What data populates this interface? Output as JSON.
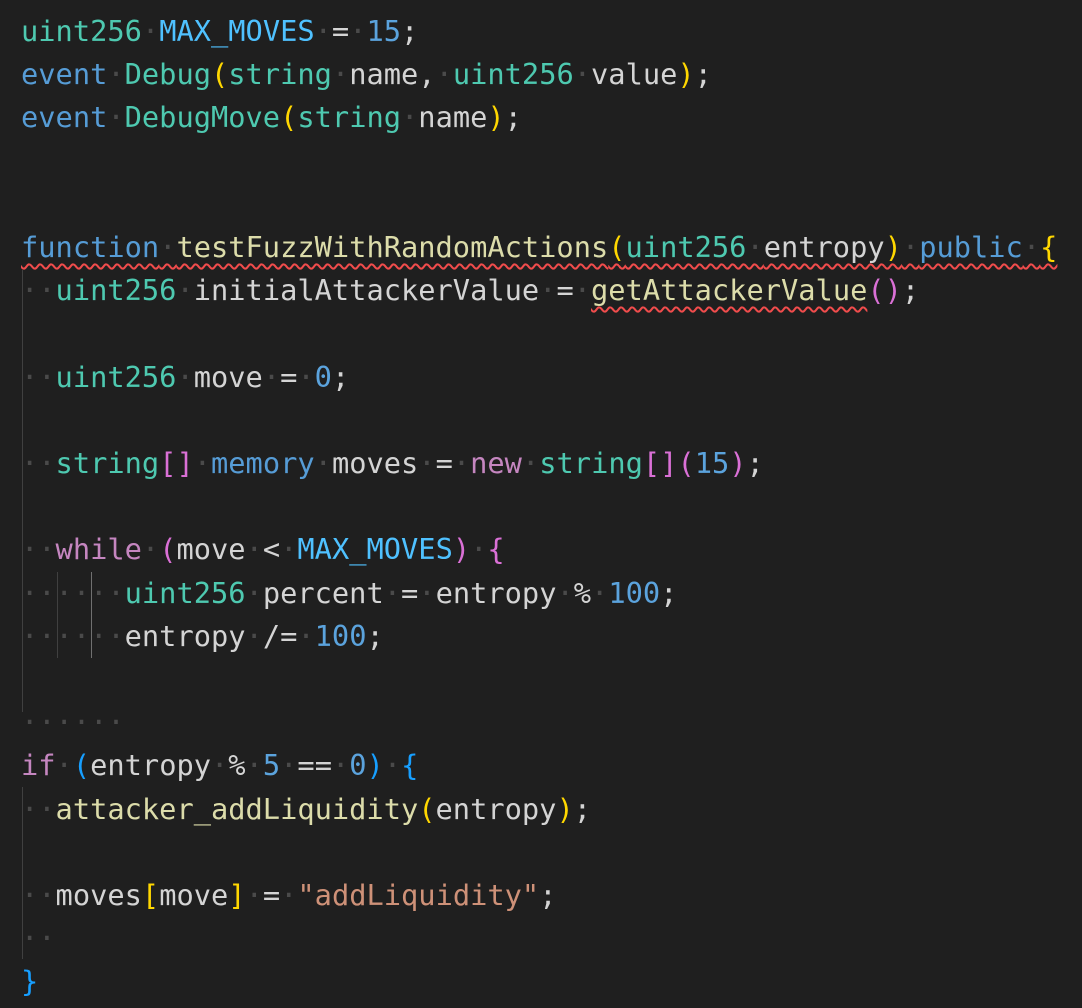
{
  "colors": {
    "background": "#1f1f1f",
    "keyword": "#569cd6",
    "control": "#c586c0",
    "type": "#4ec9b0",
    "function": "#dcdcaa",
    "variable": "#d4d4d4",
    "constant": "#4fc1ff",
    "number": "#5ba3dd",
    "string": "#ce9178",
    "bracket1": "#ffd700",
    "bracket2": "#da70d6",
    "bracket3": "#179fff",
    "whitespace": "#4a4a4a",
    "error": "#f14c4c"
  },
  "lines": [
    {
      "tokens": [
        {
          "t": "uint256",
          "c": "type"
        },
        {
          "t": "·",
          "c": "whitespace"
        },
        {
          "t": "MAX_MOVES",
          "c": "constant"
        },
        {
          "t": "·",
          "c": "whitespace"
        },
        {
          "t": "=",
          "c": "variable"
        },
        {
          "t": "·",
          "c": "whitespace"
        },
        {
          "t": "15",
          "c": "number"
        },
        {
          "t": ";",
          "c": "variable"
        }
      ]
    },
    {
      "tokens": [
        {
          "t": "event",
          "c": "keyword"
        },
        {
          "t": "·",
          "c": "whitespace"
        },
        {
          "t": "Debug",
          "c": "type"
        },
        {
          "t": "(",
          "c": "bracket1"
        },
        {
          "t": "string",
          "c": "type"
        },
        {
          "t": "·",
          "c": "whitespace"
        },
        {
          "t": "name,",
          "c": "variable"
        },
        {
          "t": "·",
          "c": "whitespace"
        },
        {
          "t": "uint256",
          "c": "type"
        },
        {
          "t": "·",
          "c": "whitespace"
        },
        {
          "t": "value",
          "c": "variable"
        },
        {
          "t": ")",
          "c": "bracket1"
        },
        {
          "t": ";",
          "c": "variable"
        }
      ]
    },
    {
      "tokens": [
        {
          "t": "event",
          "c": "keyword"
        },
        {
          "t": "·",
          "c": "whitespace"
        },
        {
          "t": "DebugMove",
          "c": "type"
        },
        {
          "t": "(",
          "c": "bracket1"
        },
        {
          "t": "string",
          "c": "type"
        },
        {
          "t": "·",
          "c": "whitespace"
        },
        {
          "t": "name",
          "c": "variable"
        },
        {
          "t": ")",
          "c": "bracket1"
        },
        {
          "t": ";",
          "c": "variable"
        }
      ]
    },
    {
      "tokens": []
    },
    {
      "tokens": []
    },
    {
      "tokens": [
        {
          "t": "function",
          "c": "keyword",
          "err": true
        },
        {
          "t": "·",
          "c": "whitespace",
          "err": true
        },
        {
          "t": "testFuzzWithRandomActions",
          "c": "function",
          "err": true
        },
        {
          "t": "(",
          "c": "bracket1",
          "err": true
        },
        {
          "t": "uint256",
          "c": "type",
          "err": true
        },
        {
          "t": "·",
          "c": "whitespace",
          "err": true
        },
        {
          "t": "entropy",
          "c": "variable",
          "err": true
        },
        {
          "t": ")",
          "c": "bracket1",
          "err": true
        },
        {
          "t": "·",
          "c": "whitespace",
          "err": true
        },
        {
          "t": "public",
          "c": "keyword",
          "err": true
        },
        {
          "t": "·",
          "c": "whitespace",
          "err": true
        },
        {
          "t": "{",
          "c": "bracket1",
          "err": true
        }
      ]
    },
    {
      "tokens": [
        {
          "t": "··",
          "c": "whitespace"
        },
        {
          "t": "uint256",
          "c": "type"
        },
        {
          "t": "·",
          "c": "whitespace"
        },
        {
          "t": "initialAttackerValue",
          "c": "variable"
        },
        {
          "t": "·",
          "c": "whitespace"
        },
        {
          "t": "=",
          "c": "variable"
        },
        {
          "t": "·",
          "c": "whitespace"
        },
        {
          "t": "getAttackerValue",
          "c": "function",
          "err": true
        },
        {
          "t": "()",
          "c": "bracket2"
        },
        {
          "t": ";",
          "c": "variable"
        }
      ]
    },
    {
      "tokens": []
    },
    {
      "tokens": [
        {
          "t": "··",
          "c": "whitespace"
        },
        {
          "t": "uint256",
          "c": "type"
        },
        {
          "t": "·",
          "c": "whitespace"
        },
        {
          "t": "move",
          "c": "variable"
        },
        {
          "t": "·",
          "c": "whitespace"
        },
        {
          "t": "=",
          "c": "variable"
        },
        {
          "t": "·",
          "c": "whitespace"
        },
        {
          "t": "0",
          "c": "number"
        },
        {
          "t": ";",
          "c": "variable"
        }
      ]
    },
    {
      "tokens": []
    },
    {
      "tokens": [
        {
          "t": "··",
          "c": "whitespace"
        },
        {
          "t": "string",
          "c": "type"
        },
        {
          "t": "[]",
          "c": "bracket2"
        },
        {
          "t": "·",
          "c": "whitespace"
        },
        {
          "t": "memory",
          "c": "keyword"
        },
        {
          "t": "·",
          "c": "whitespace"
        },
        {
          "t": "moves",
          "c": "variable"
        },
        {
          "t": "·",
          "c": "whitespace"
        },
        {
          "t": "=",
          "c": "variable"
        },
        {
          "t": "·",
          "c": "whitespace"
        },
        {
          "t": "new",
          "c": "control"
        },
        {
          "t": "·",
          "c": "whitespace"
        },
        {
          "t": "string",
          "c": "type"
        },
        {
          "t": "[]",
          "c": "bracket2"
        },
        {
          "t": "(",
          "c": "bracket2"
        },
        {
          "t": "15",
          "c": "number"
        },
        {
          "t": ")",
          "c": "bracket2"
        },
        {
          "t": ";",
          "c": "variable"
        }
      ]
    },
    {
      "tokens": []
    },
    {
      "tokens": [
        {
          "t": "··",
          "c": "whitespace"
        },
        {
          "t": "while",
          "c": "control"
        },
        {
          "t": "·",
          "c": "whitespace"
        },
        {
          "t": "(",
          "c": "bracket2"
        },
        {
          "t": "move",
          "c": "variable"
        },
        {
          "t": "·",
          "c": "whitespace"
        },
        {
          "t": "<",
          "c": "variable"
        },
        {
          "t": "·",
          "c": "whitespace"
        },
        {
          "t": "MAX_MOVES",
          "c": "constant"
        },
        {
          "t": ")",
          "c": "bracket2"
        },
        {
          "t": "·",
          "c": "whitespace"
        },
        {
          "t": "{",
          "c": "bracket2"
        }
      ]
    },
    {
      "tokens": [
        {
          "t": "······",
          "c": "whitespace"
        },
        {
          "t": "uint256",
          "c": "type"
        },
        {
          "t": "·",
          "c": "whitespace"
        },
        {
          "t": "percent",
          "c": "variable"
        },
        {
          "t": "·",
          "c": "whitespace"
        },
        {
          "t": "=",
          "c": "variable"
        },
        {
          "t": "·",
          "c": "whitespace"
        },
        {
          "t": "entropy",
          "c": "variable"
        },
        {
          "t": "·",
          "c": "whitespace"
        },
        {
          "t": "%",
          "c": "variable"
        },
        {
          "t": "·",
          "c": "whitespace"
        },
        {
          "t": "100",
          "c": "number"
        },
        {
          "t": ";",
          "c": "variable"
        }
      ]
    },
    {
      "tokens": [
        {
          "t": "······",
          "c": "whitespace"
        },
        {
          "t": "entropy",
          "c": "variable"
        },
        {
          "t": "·",
          "c": "whitespace"
        },
        {
          "t": "/=",
          "c": "variable"
        },
        {
          "t": "·",
          "c": "whitespace"
        },
        {
          "t": "100",
          "c": "number"
        },
        {
          "t": ";",
          "c": "variable"
        }
      ]
    },
    {
      "tokens": []
    },
    {
      "tokens": [
        {
          "t": "······",
          "c": "whitespace"
        }
      ]
    },
    {
      "tokens": [
        {
          "t": "if",
          "c": "control"
        },
        {
          "t": "·",
          "c": "whitespace"
        },
        {
          "t": "(",
          "c": "bracket3"
        },
        {
          "t": "entropy",
          "c": "variable"
        },
        {
          "t": "·",
          "c": "whitespace"
        },
        {
          "t": "%",
          "c": "variable"
        },
        {
          "t": "·",
          "c": "whitespace"
        },
        {
          "t": "5",
          "c": "number"
        },
        {
          "t": "·",
          "c": "whitespace"
        },
        {
          "t": "==",
          "c": "variable"
        },
        {
          "t": "·",
          "c": "whitespace"
        },
        {
          "t": "0",
          "c": "number"
        },
        {
          "t": ")",
          "c": "bracket3"
        },
        {
          "t": "·",
          "c": "whitespace"
        },
        {
          "t": "{",
          "c": "bracket3"
        }
      ]
    },
    {
      "tokens": [
        {
          "t": "··",
          "c": "whitespace"
        },
        {
          "t": "attacker_addLiquidity",
          "c": "function"
        },
        {
          "t": "(",
          "c": "bracket1"
        },
        {
          "t": "entropy",
          "c": "variable"
        },
        {
          "t": ")",
          "c": "bracket1"
        },
        {
          "t": ";",
          "c": "variable"
        }
      ]
    },
    {
      "tokens": []
    },
    {
      "tokens": [
        {
          "t": "··",
          "c": "whitespace"
        },
        {
          "t": "moves",
          "c": "variable"
        },
        {
          "t": "[",
          "c": "bracket1"
        },
        {
          "t": "move",
          "c": "variable"
        },
        {
          "t": "]",
          "c": "bracket1"
        },
        {
          "t": "·",
          "c": "whitespace"
        },
        {
          "t": "=",
          "c": "variable"
        },
        {
          "t": "·",
          "c": "whitespace"
        },
        {
          "t": "\"addLiquidity\"",
          "c": "string"
        },
        {
          "t": ";",
          "c": "variable"
        }
      ]
    },
    {
      "tokens": [
        {
          "t": "··",
          "c": "whitespace"
        }
      ]
    },
    {
      "tokens": [
        {
          "t": "}",
          "c": "bracket3"
        }
      ]
    }
  ]
}
